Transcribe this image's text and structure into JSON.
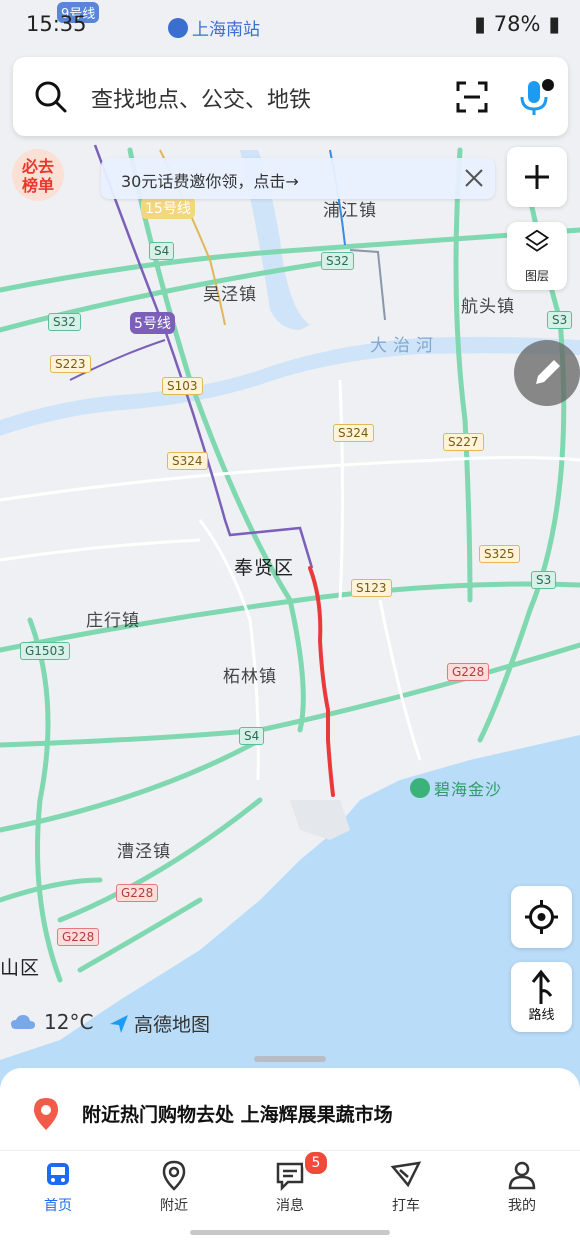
{
  "status_bar": {
    "time": "15:35",
    "battery": "78%"
  },
  "search": {
    "placeholder": "查找地点、公交、地铁"
  },
  "promo": {
    "badge_text": "必去榜单",
    "banner_text": "30元话费邀你领，点击→"
  },
  "map_controls": {
    "layers_label": "图层",
    "route_label": "路线"
  },
  "map_labels": {
    "stations": [
      "9号线",
      "上海南站"
    ],
    "metro_lines": [
      "15号线",
      "5号线"
    ],
    "places": [
      "浦江镇",
      "吴泾镇",
      "航头镇",
      "大治河",
      "奉贤区",
      "庄行镇",
      "柘林镇",
      "漕泾镇",
      "山区",
      "碧海金沙"
    ],
    "road_shields": [
      "S4",
      "S32",
      "S32",
      "S3",
      "S223",
      "S103",
      "S324",
      "S324",
      "S227",
      "S325",
      "S3",
      "S123",
      "G1503",
      "G228",
      "S4",
      "G228",
      "G228"
    ]
  },
  "weather": {
    "temp": "12°C"
  },
  "brand": {
    "name": "高德地图"
  },
  "bottom_sheet": {
    "suggestion": "附近热门购物去处 上海辉展果蔬市场"
  },
  "tabs": [
    {
      "label": "首页",
      "active": true
    },
    {
      "label": "附近",
      "active": false
    },
    {
      "label": "消息",
      "active": false,
      "badge": "5"
    },
    {
      "label": "打车",
      "active": false
    },
    {
      "label": "我的",
      "active": false
    }
  ],
  "colors": {
    "accent": "#1b6cf2",
    "highway": "#7fd8b0",
    "water": "#b9dcf8",
    "route_highlight": "#e83a3a",
    "metro_purple": "#7b5fb8"
  }
}
